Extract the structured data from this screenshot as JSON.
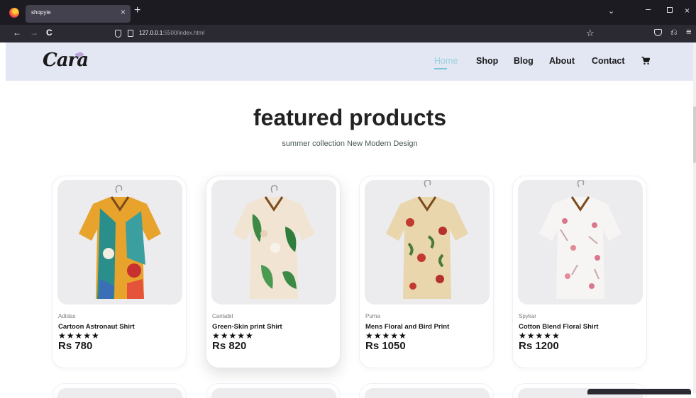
{
  "browser": {
    "tab_title": "shopyie",
    "tab_close": "×",
    "new_tab": "+",
    "nav_back": "←",
    "nav_forward": "→",
    "nav_reload": "C",
    "url_host": "127.0.0.1",
    "url_path": ":5500/index.html",
    "tabs_list": "⌄",
    "minimize": "–",
    "close": "×",
    "bookmark": "☆",
    "extensions": "⎌",
    "menu": "≡"
  },
  "header": {
    "logo": "Cara",
    "nav": [
      {
        "label": "Home",
        "active": true
      },
      {
        "label": "Shop"
      },
      {
        "label": "Blog"
      },
      {
        "label": "About"
      },
      {
        "label": "Contact"
      }
    ]
  },
  "section": {
    "title": "featured products",
    "subtitle": "summer collection New Modern Design"
  },
  "products": [
    {
      "brand": "Adidas",
      "name": "Cartoon Astronaut Shirt",
      "stars": "★★★★★",
      "price": "Rs 780"
    },
    {
      "brand": "Cantabil",
      "name": "Green-Skin print Shirt",
      "stars": "★★★★★",
      "price": "Rs 820"
    },
    {
      "brand": "Puma",
      "name": "Mens Floral and Bird Print",
      "stars": "★★★★★",
      "price": "Rs 1050"
    },
    {
      "brand": "Spykar",
      "name": "Cotton Blend Floral Shirt",
      "stars": "★★★★★",
      "price": "Rs 1200"
    }
  ],
  "colors": {
    "header_bg": "#e3e6f3",
    "active_nav": "#9bd2e0",
    "browser_dark": "#1c1b22",
    "toolbar": "#2b2a33"
  }
}
